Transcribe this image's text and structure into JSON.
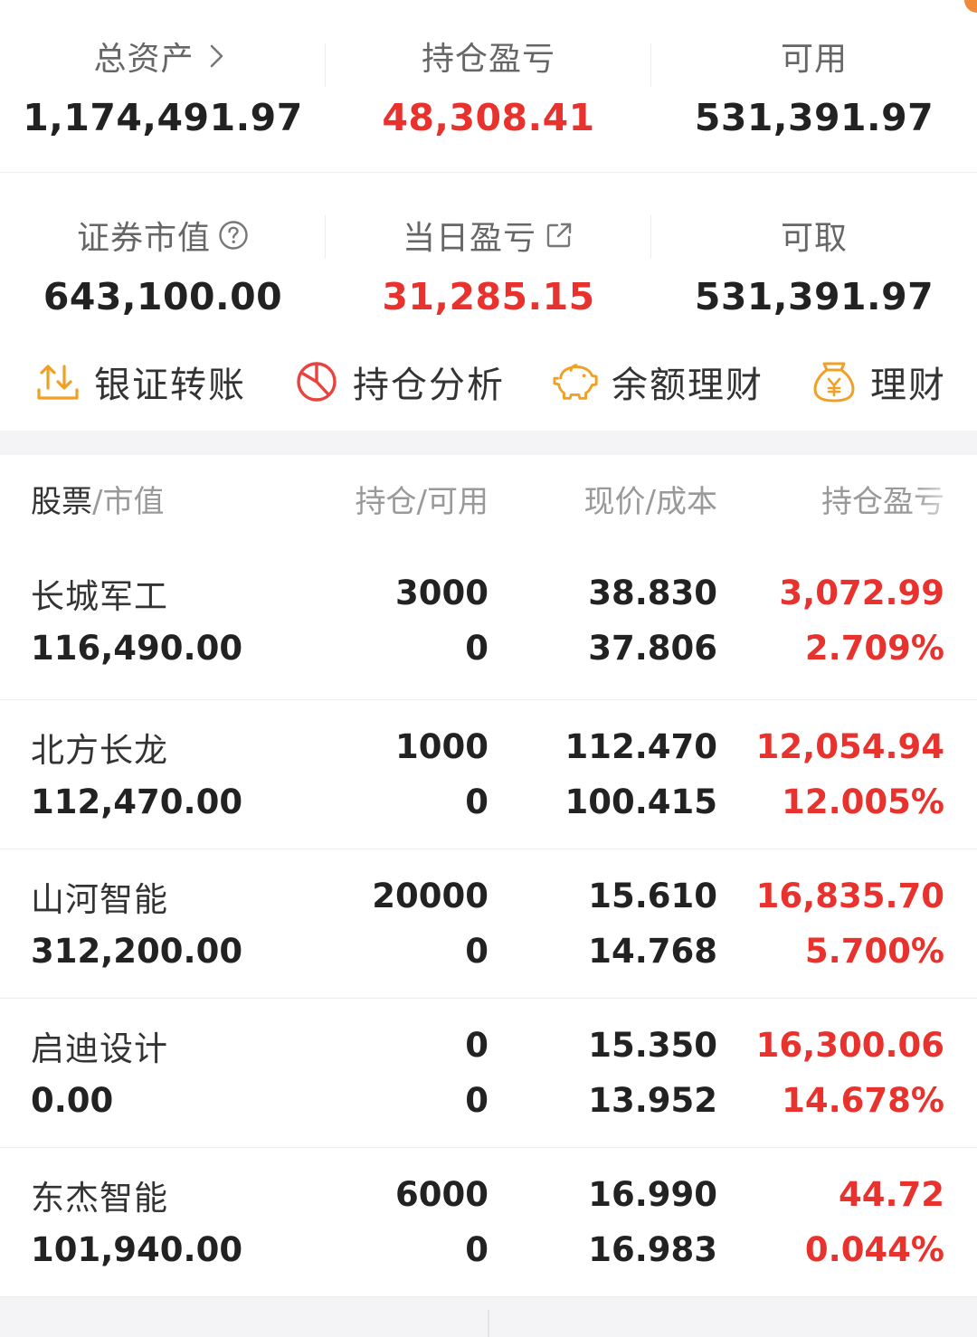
{
  "summary_top": [
    {
      "label": "总资产",
      "value": "1,174,491.97",
      "red": false,
      "icon": "chevron-right-icon"
    },
    {
      "label": "持仓盈亏",
      "value": "48,308.41",
      "red": true
    },
    {
      "label": "可用",
      "value": "531,391.97",
      "red": false
    }
  ],
  "summary_bottom": [
    {
      "label": "证券市值",
      "value": "643,100.00",
      "red": false,
      "icon": "question-circle-icon"
    },
    {
      "label": "当日盈亏",
      "value": "31,285.15",
      "red": true,
      "icon": "external-link-icon"
    },
    {
      "label": "可取",
      "value": "531,391.97",
      "red": false
    }
  ],
  "quick_actions": [
    {
      "label": "银证转账",
      "icon": "transfer-icon"
    },
    {
      "label": "持仓分析",
      "icon": "pie-chart-icon"
    },
    {
      "label": "余额理财",
      "icon": "piggy-bank-icon"
    },
    {
      "label": "理财",
      "icon": "money-bag-icon"
    }
  ],
  "table": {
    "header": {
      "col1_main": "股票",
      "col1_sub": "/市值",
      "col2": "持仓/可用",
      "col3": "现价/成本",
      "col4": "持仓盈亏"
    },
    "rows": [
      {
        "name": "长城军工",
        "market_value": "116,490.00",
        "position": "3000",
        "available": "0",
        "price": "38.830",
        "cost": "37.806",
        "pnl": "3,072.99",
        "pnl_pct": "2.709%"
      },
      {
        "name": "北方长龙",
        "market_value": "112,470.00",
        "position": "1000",
        "available": "0",
        "price": "112.470",
        "cost": "100.415",
        "pnl": "12,054.94",
        "pnl_pct": "12.005%"
      },
      {
        "name": "山河智能",
        "market_value": "312,200.00",
        "position": "20000",
        "available": "0",
        "price": "15.610",
        "cost": "14.768",
        "pnl": "16,835.70",
        "pnl_pct": "5.700%"
      },
      {
        "name": "启迪设计",
        "market_value": "0.00",
        "position": "0",
        "available": "0",
        "price": "15.350",
        "cost": "13.952",
        "pnl": "16,300.06",
        "pnl_pct": "14.678%"
      },
      {
        "name": "东杰智能",
        "market_value": "101,940.00",
        "position": "6000",
        "available": "0",
        "price": "16.990",
        "cost": "16.983",
        "pnl": "44.72",
        "pnl_pct": "0.044%"
      }
    ]
  },
  "colors": {
    "profit_red": "#e8322e",
    "accent_orange": "#f08a3a"
  }
}
